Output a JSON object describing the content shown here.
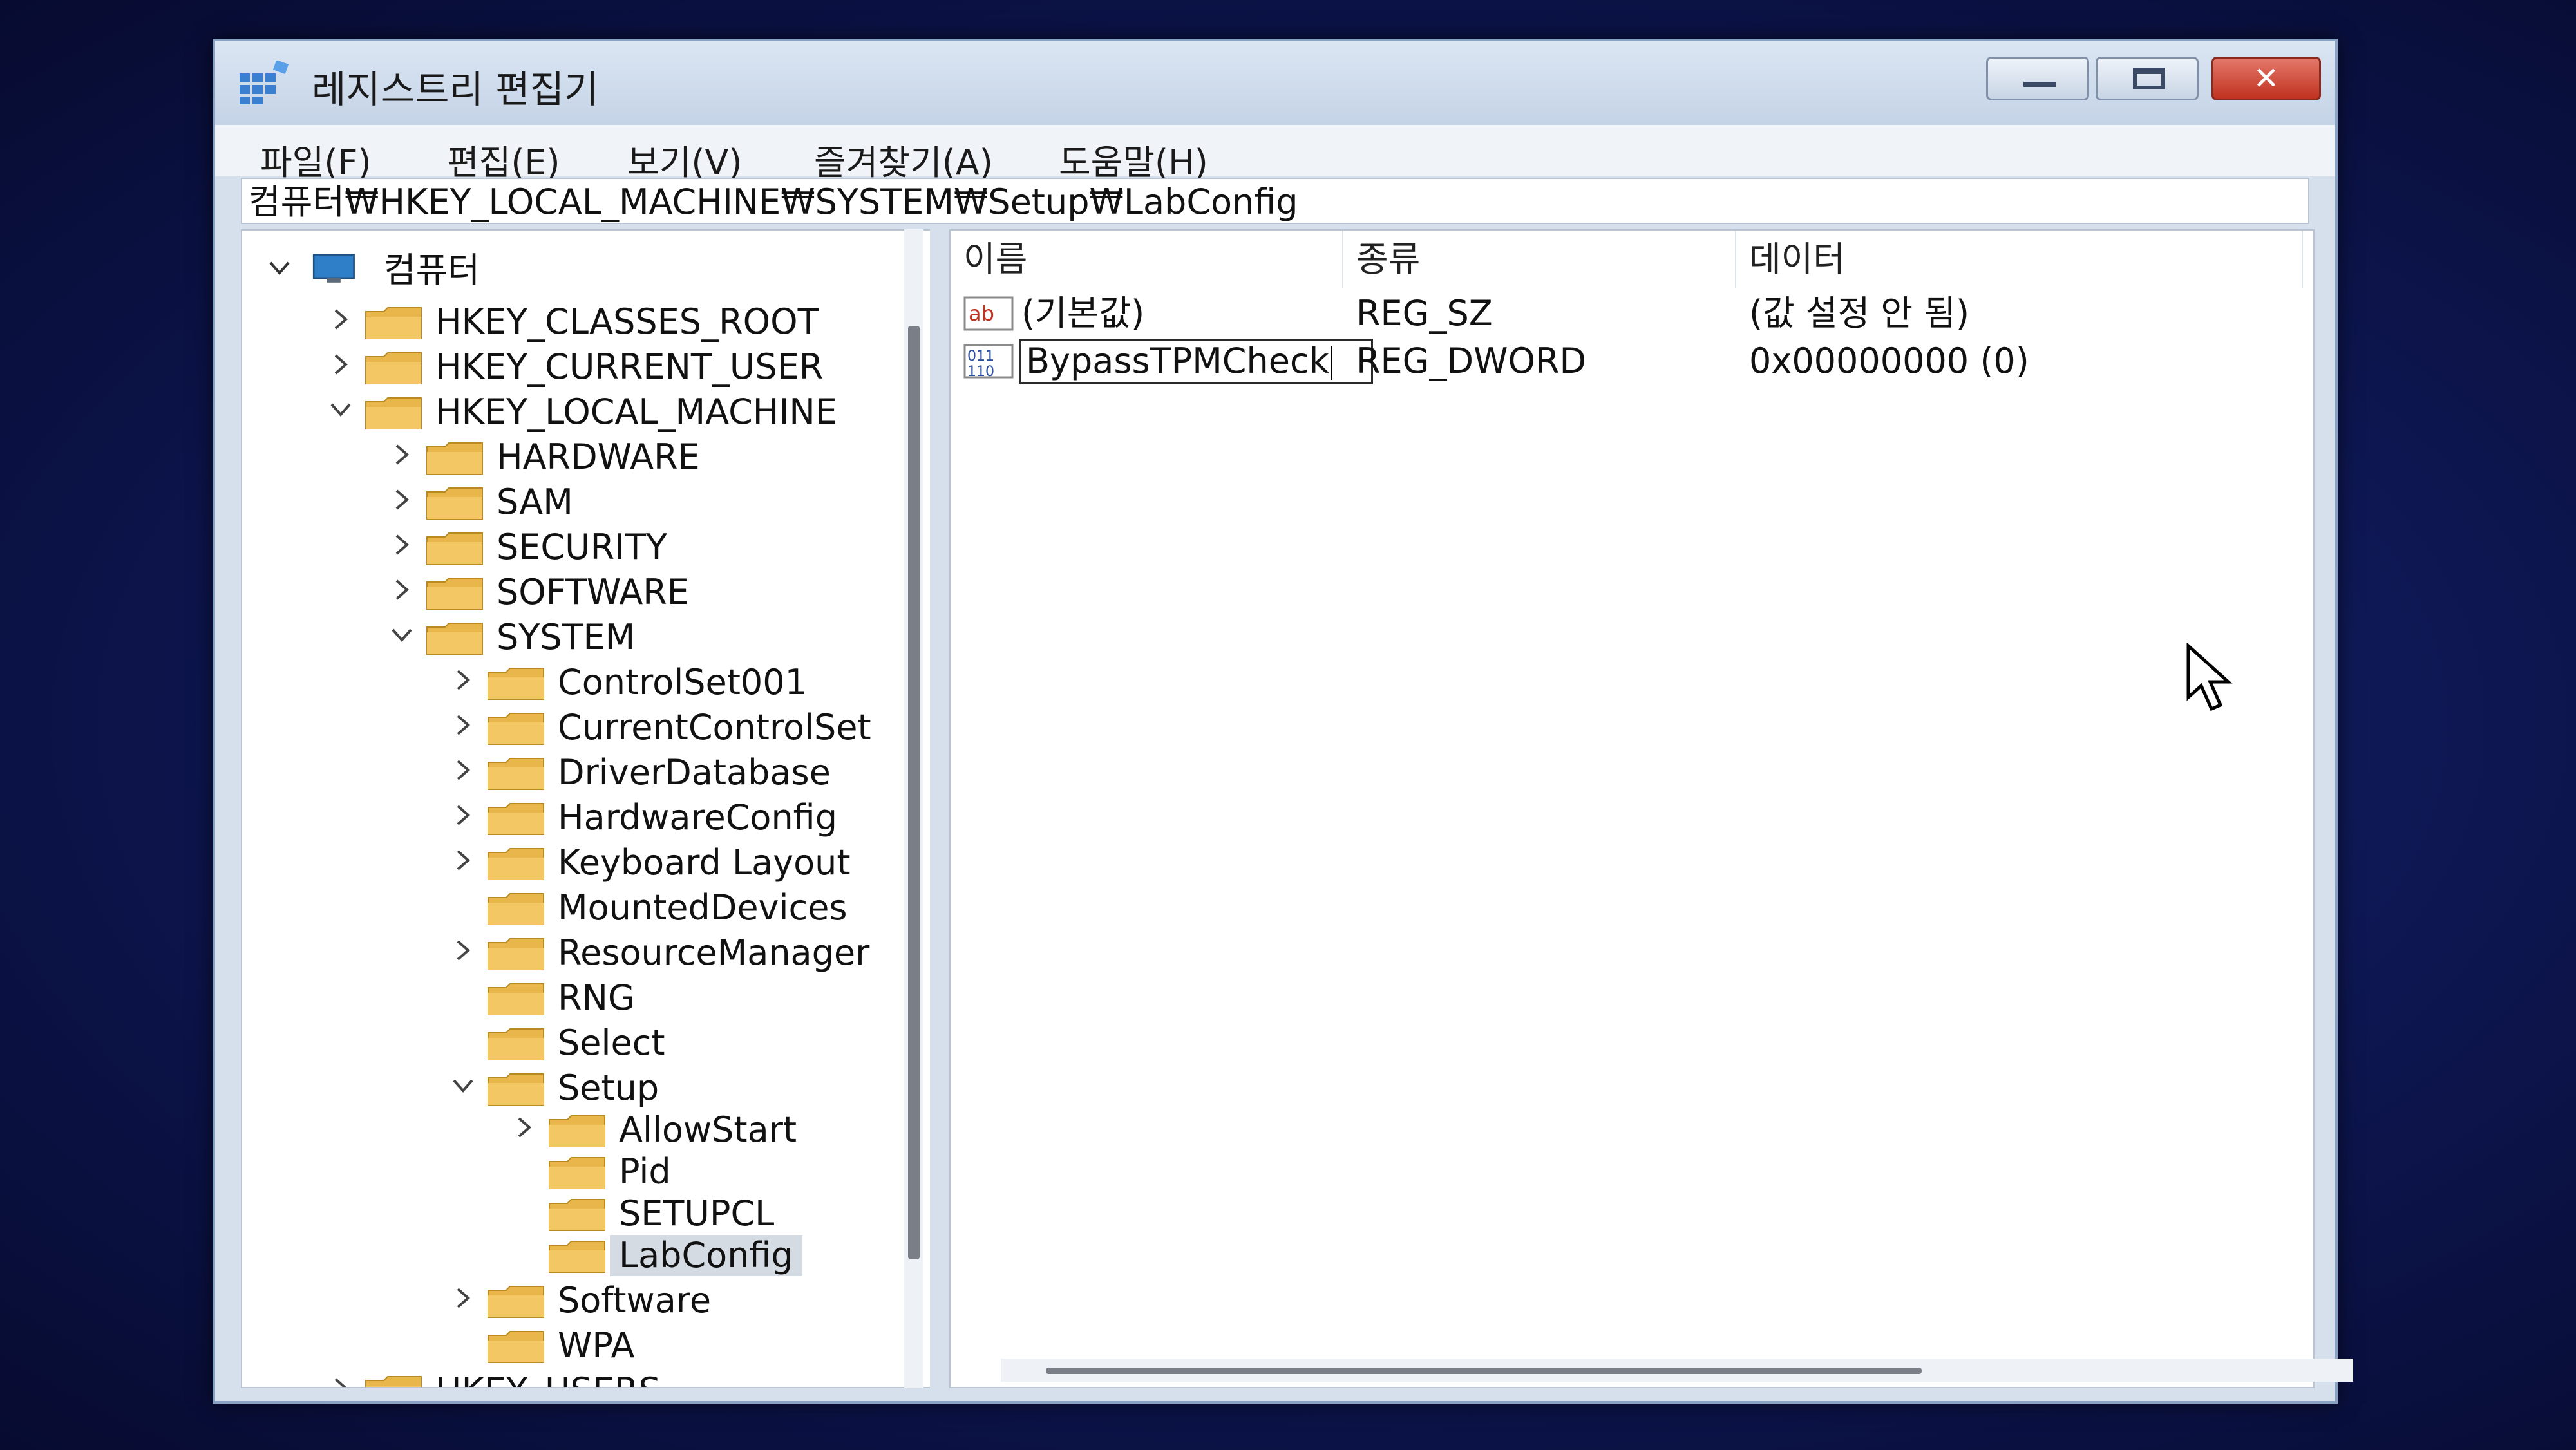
{
  "window": {
    "title": "레지스트리 편집기"
  },
  "menu": [
    "파일(F)",
    "편집(E)",
    "보기(V)",
    "즐겨찾기(A)",
    "도움말(H)"
  ],
  "address": "컴퓨터₩HKEY_LOCAL_MACHINE₩SYSTEM₩Setup₩LabConfig",
  "tree": {
    "root": "컴퓨터",
    "items": [
      {
        "label": "HKEY_CLASSES_ROOT",
        "expanded": false
      },
      {
        "label": "HKEY_CURRENT_USER",
        "expanded": false
      },
      {
        "label": "HKEY_LOCAL_MACHINE",
        "expanded": true
      },
      {
        "label": "HARDWARE",
        "expanded": false
      },
      {
        "label": "SAM",
        "expanded": false
      },
      {
        "label": "SECURITY",
        "expanded": false
      },
      {
        "label": "SOFTWARE",
        "expanded": false
      },
      {
        "label": "SYSTEM",
        "expanded": true
      },
      {
        "label": "ControlSet001",
        "expanded": false
      },
      {
        "label": "CurrentControlSet",
        "expanded": false
      },
      {
        "label": "DriverDatabase",
        "expanded": false
      },
      {
        "label": "HardwareConfig",
        "expanded": false
      },
      {
        "label": "Keyboard Layout",
        "expanded": false
      },
      {
        "label": "MountedDevices",
        "expanded": false
      },
      {
        "label": "ResourceManager",
        "expanded": false
      },
      {
        "label": "RNG",
        "expanded": false
      },
      {
        "label": "Select",
        "expanded": false
      },
      {
        "label": "Setup",
        "expanded": true
      },
      {
        "label": "AllowStart",
        "expanded": false
      },
      {
        "label": "Pid",
        "expanded": false
      },
      {
        "label": "SETUPCL",
        "expanded": false
      },
      {
        "label": "LabConfig",
        "selected": true
      },
      {
        "label": "Software",
        "expanded": false
      },
      {
        "label": "WPA",
        "expanded": false
      },
      {
        "label": "HKEY_USERS",
        "expanded": false
      }
    ]
  },
  "values": {
    "columns": [
      "이름",
      "종류",
      "데이터"
    ],
    "rows": [
      {
        "icon": "string-value-icon",
        "name": "(기본값)",
        "type": "REG_SZ",
        "data": "(값 설정 안 됨)"
      },
      {
        "icon": "dword-value-icon",
        "name": "BypassTPMCheck",
        "type": "REG_DWORD",
        "data": "0x00000000 (0)",
        "editing": true
      }
    ]
  },
  "colors": {
    "background": "#0d1650",
    "close_button": "#c0321f",
    "folder": "#e8b64a"
  }
}
